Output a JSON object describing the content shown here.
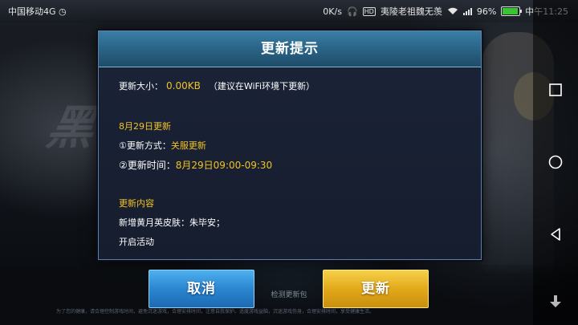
{
  "status_bar": {
    "carrier": "中国移动4G",
    "net_speed": "0K/s",
    "hd": "HD",
    "notice": "夷陵老祖魏无羡",
    "signal_tag": "4G",
    "battery_pct": "96%",
    "battery_level": 0.96,
    "time": "中午11:25"
  },
  "dialog": {
    "title": "更新提示",
    "size_label": "更新大小：",
    "size_value": "0.00KB",
    "size_note": "（建议在WiFi环境下更新）",
    "date_heading": "8月29日更新",
    "method_label": "①更新方式：",
    "method_value": "关服更新",
    "time_label": "②更新时间：",
    "time_value": "8月29日09:00-09:30",
    "content_heading": "更新内容",
    "content_line1": "新增黄月英皮肤：朱毕安；",
    "content_line2": "开启活动"
  },
  "buttons": {
    "cancel": "取消",
    "update": "更新",
    "check": "检测更新包"
  },
  "background": {
    "ghost_text": "黑",
    "footer": "为了您的健康，请合理控制游戏时间，避免沉迷游戏，合理安排时间，注意自我保护。适度游戏益脑，沉迷游戏伤身，合理安排时间，享受健康生活。"
  },
  "colors": {
    "accent_yellow": "#f2c225",
    "header_blue": "#2b6688",
    "cancel_blue": "#2a86cf",
    "update_gold": "#e2a91a"
  }
}
